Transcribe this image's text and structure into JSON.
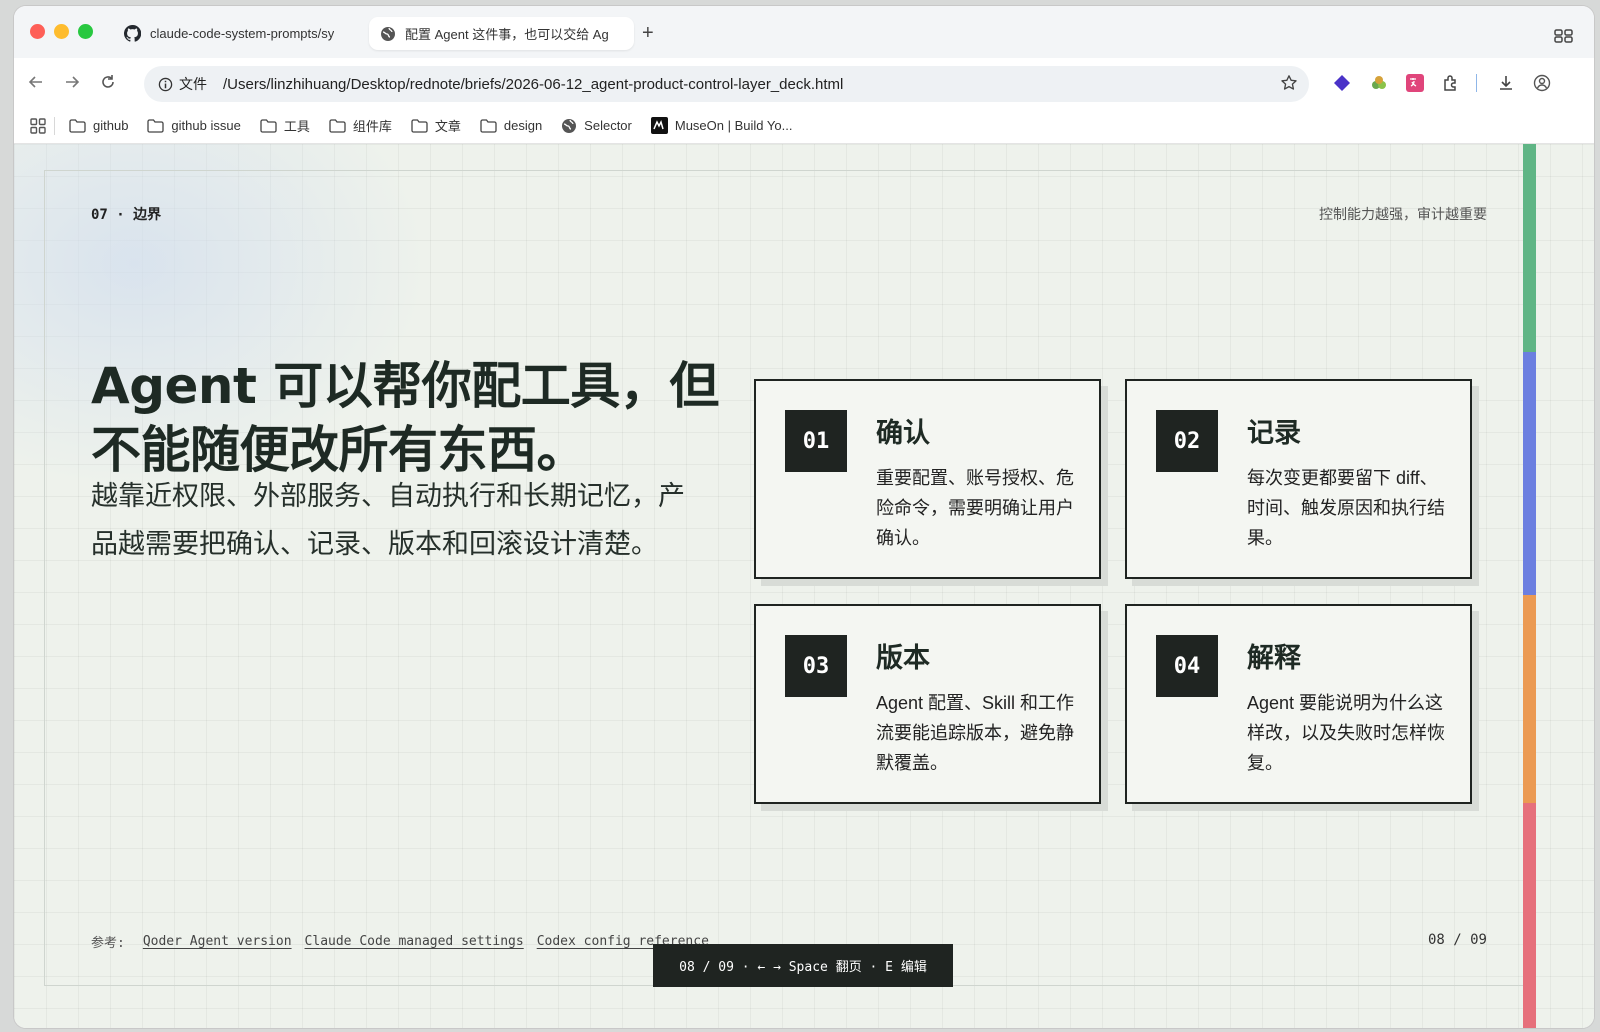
{
  "browser": {
    "tabs": [
      {
        "label": "claude-code-system-prompts/sy",
        "icon": "github-icon",
        "active": false
      },
      {
        "label": "配置 Agent 这件事，也可以交给 Ag",
        "icon": "globe-icon",
        "active": true
      }
    ],
    "new_tab_label": "+",
    "address": {
      "scheme_label": "文件",
      "url": "/Users/linzhihuang/Desktop/rednote/briefs/2026-06-12_agent-product-control-layer_deck.html"
    },
    "bookmarks": [
      {
        "label": "github",
        "icon": "folder-icon"
      },
      {
        "label": "github issue",
        "icon": "folder-icon"
      },
      {
        "label": "工具",
        "icon": "folder-icon"
      },
      {
        "label": "组件库",
        "icon": "folder-icon"
      },
      {
        "label": "文章",
        "icon": "folder-icon"
      },
      {
        "label": "design",
        "icon": "folder-icon"
      },
      {
        "label": "Selector",
        "icon": "globe-icon"
      },
      {
        "label": "MuseOn | Build Yo...",
        "icon": "museon-icon"
      }
    ]
  },
  "slide": {
    "kicker": "07 · 边界",
    "tagline": "控制能力越强，审计越重要",
    "headline": "Agent 可以帮你配工具，但不能随便改所有东西。",
    "lede": "越靠近权限、外部服务、自动执行和长期记忆，产品越需要把确认、记录、版本和回滚设计清楚。",
    "cards": [
      {
        "num": "01",
        "title": "确认",
        "body": "重要配置、账号授权、危险命令，需要明确让用户确认。"
      },
      {
        "num": "02",
        "title": "记录",
        "body": "每次变更都要留下 diff、时间、触发原因和执行结果。"
      },
      {
        "num": "03",
        "title": "版本",
        "body": "Agent 配置、Skill 和工作流要能追踪版本，避免静默覆盖。"
      },
      {
        "num": "04",
        "title": "解释",
        "body": "Agent 要能说明为什么这样改，以及失败时怎样恢复。"
      }
    ],
    "accent_colors": [
      "#5fb585",
      "#6b7fe0",
      "#eb9a52",
      "#e6707b"
    ],
    "refs_label": "参考:",
    "refs": [
      "Qoder Agent version",
      "Claude Code managed settings",
      "Codex config reference"
    ],
    "page_number": "08 / 09",
    "hud_text": "08 / 09 · ← → Space 翻页 · E 编辑"
  }
}
